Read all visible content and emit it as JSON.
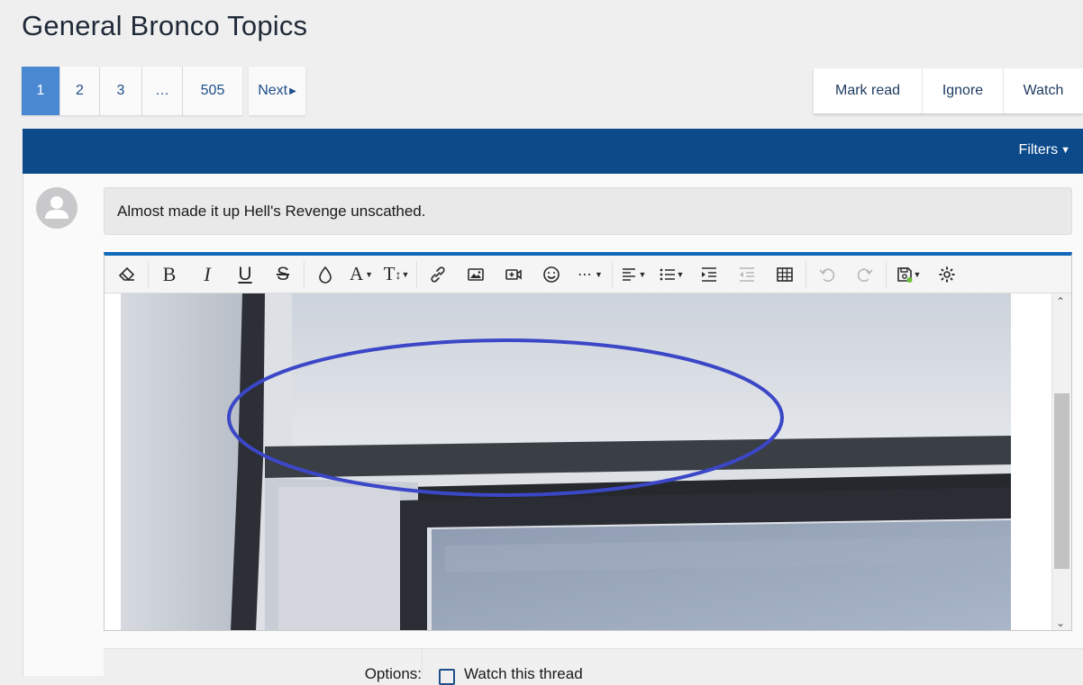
{
  "page": {
    "title": "General Bronco Topics"
  },
  "pagination": {
    "pages": [
      "1",
      "2",
      "3",
      "…",
      "505"
    ],
    "active": "1",
    "next_label": "Next"
  },
  "thread_actions": [
    "Mark read",
    "Ignore",
    "Watch"
  ],
  "filter_bar": {
    "filters_label": "Filters",
    "color": "#0c4a8a"
  },
  "form": {
    "title_value": "Almost made it up Hell's Revenge unscathed.",
    "options_label": "Options:",
    "watch_option": "Watch this thread"
  },
  "toolbar": {
    "buttons": [
      "remove-format-icon",
      "bold-icon",
      "italic-icon",
      "underline-icon",
      "strikethrough-icon",
      "text-color-icon",
      "font-family-icon",
      "font-size-icon",
      "insert-link-icon",
      "insert-image-icon",
      "insert-media-icon",
      "smilies-icon",
      "more-options-icon",
      "align-icon",
      "list-icon",
      "indent-icon",
      "outdent-icon",
      "table-icon",
      "undo-icon",
      "redo-icon",
      "drafts-icon",
      "toggle-bbcode-icon"
    ]
  },
  "colors": {
    "accent": "#4a88d2",
    "editor_top": "#1069b8",
    "link": "#1d4e89",
    "annotation": "#3b47c7"
  }
}
